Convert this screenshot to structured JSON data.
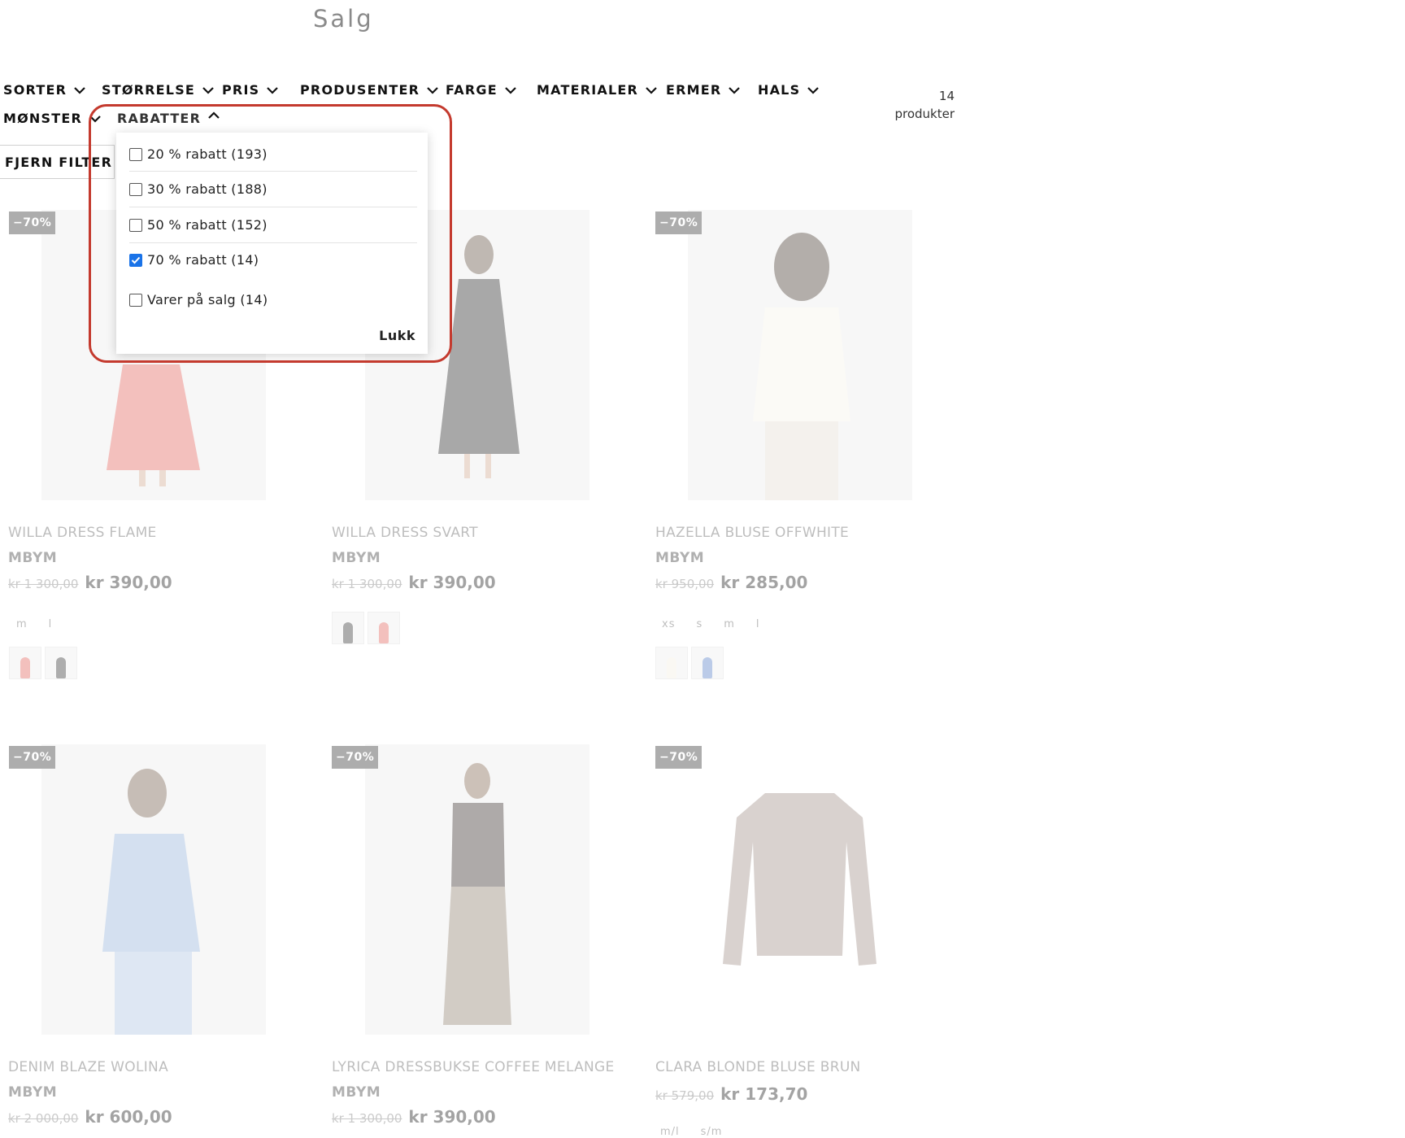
{
  "page": {
    "title": "Salg"
  },
  "filters": {
    "items": [
      {
        "label": "SORTER",
        "state": "collapsed"
      },
      {
        "label": "STØRRELSE",
        "state": "collapsed"
      },
      {
        "label": "PRIS",
        "state": "collapsed"
      },
      {
        "label": "PRODUSENTER",
        "state": "collapsed"
      },
      {
        "label": "FARGE",
        "state": "collapsed"
      },
      {
        "label": "MATERIALER",
        "state": "collapsed"
      },
      {
        "label": "ERMER",
        "state": "collapsed"
      },
      {
        "label": "HALS",
        "state": "collapsed"
      },
      {
        "label": "MØNSTER",
        "state": "collapsed"
      },
      {
        "label": "RABATTER",
        "state": "expanded"
      }
    ],
    "count_number": "14",
    "count_unit": "produkter",
    "clear_label": "FJERN FILTER"
  },
  "dropdown": {
    "options": [
      {
        "label": "20 % rabatt (193)",
        "checked": false
      },
      {
        "label": "30 % rabatt (188)",
        "checked": false
      },
      {
        "label": "50 % rabatt (152)",
        "checked": false
      },
      {
        "label": "70 % rabatt (14)",
        "checked": true
      },
      {
        "label": "Varer på salg (14)",
        "checked": false
      }
    ],
    "close_label": "Lukk"
  },
  "products": [
    {
      "name": "WILLA DRESS FLAME",
      "brand": "MBYM",
      "old_price": "kr 1 300,00",
      "price": "kr 390,00",
      "badge": "−70%",
      "sizes": [
        "m",
        "l"
      ],
      "swatch_colors": [
        "#e05b55",
        "#2b2b2b"
      ]
    },
    {
      "name": "WILLA DRESS SVART",
      "brand": "MBYM",
      "old_price": "kr 1 300,00",
      "price": "kr 390,00",
      "badge": "",
      "sizes": [],
      "swatch_colors": [
        "#2b2b2b",
        "#e05b55"
      ]
    },
    {
      "name": "HAZELLA BLUSE OFFWHITE",
      "brand": "MBYM",
      "old_price": "kr 950,00",
      "price": "kr 285,00",
      "badge": "−70%",
      "sizes": [
        "xs",
        "s",
        "m",
        "l"
      ],
      "swatch_colors": [
        "#f3ede0",
        "#4e79c4"
      ]
    },
    {
      "name": "DENIM BLAZE WOLINA",
      "brand": "MBYM",
      "old_price": "kr 2 000,00",
      "price": "kr 600,00",
      "badge": "−70%",
      "sizes": [],
      "swatch_colors": []
    },
    {
      "name": "LYRICA DRESSBUKSE COFFEE MELANGE",
      "brand": "MBYM",
      "old_price": "kr 1 300,00",
      "price": "kr 390,00",
      "badge": "−70%",
      "sizes": [],
      "swatch_colors": []
    },
    {
      "name": "CLARA BLONDE BLUSE BRUN",
      "brand": "",
      "old_price": "kr 579,00",
      "price": "kr 173,70",
      "badge": "−70%",
      "sizes": [
        "m/l",
        "s/m"
      ],
      "swatch_colors": []
    }
  ],
  "colors": {
    "highlight": "#c43a2e",
    "checkbox_checked": "#1a73e8",
    "badge_bg": "#2a2a2a"
  }
}
